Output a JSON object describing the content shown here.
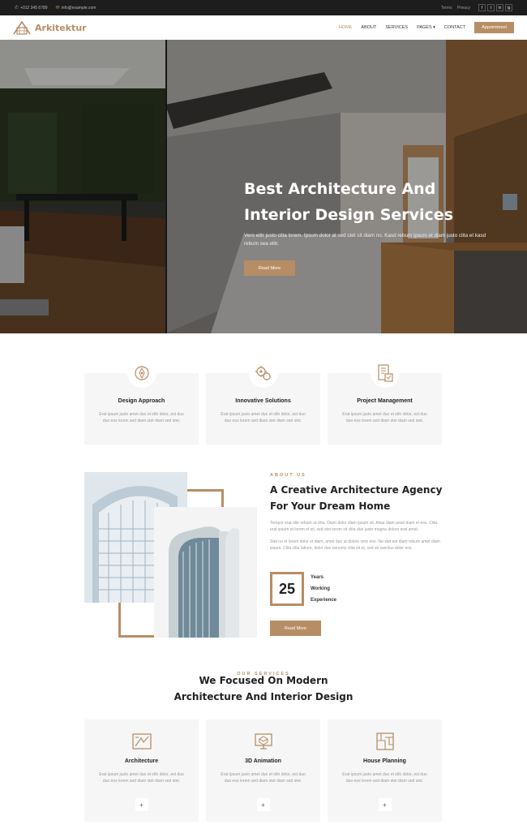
{
  "topbar": {
    "phone": "+012 345 6789",
    "email": "info@example.com",
    "links": [
      "Terms",
      "Privacy"
    ],
    "social": [
      "f",
      "t",
      "in",
      "ig"
    ]
  },
  "nav": {
    "brand": "Arkitektur",
    "items": [
      "HOME",
      "ABOUT",
      "SERVICES",
      "PAGES",
      "CONTACT"
    ],
    "active": "HOME",
    "appointment": "Appointment"
  },
  "hero": {
    "title": "Best Architecture And Interior Design Services",
    "text": "Vero elitr justo clita lorem. Ipsum dolor at sed stet sit diam no. Kasd rebum ipsum et diam justo clita et kasd rebum sea elitr.",
    "button": "Read More"
  },
  "features": [
    {
      "title": "Design Approach",
      "text": "Erat ipsum justo amet duo et elitr dolor, est duo duo eos lorem sed diam stet diam sed stet.",
      "icon": "design-approach-icon"
    },
    {
      "title": "Innovative Solutions",
      "text": "Erat ipsum justo amet duo et elitr dolor, est duo duo eos lorem sed diam stet diam sed stet.",
      "icon": "gears-icon"
    },
    {
      "title": "Project Management",
      "text": "Erat ipsum justo amet duo et elitr dolor, est duo duo eos lorem sed diam stet diam sed stet.",
      "icon": "project-management-icon"
    }
  ],
  "about": {
    "kicker": "ABOUT US",
    "title": "A Creative Architecture Agency For Your Dream Home",
    "para1": "Tempor erat elitr rebum at clita. Diam dolor diam ipsum sit. Aliqu diam amet diam et eos. Clita erat ipsum et lorem et sit, sed stet lorem sit clita duo justo magna dolore erat amet.",
    "para2": "Stet no et lorem dolor et diam, amet duo ut dolore vero eos. No stet est diam rebum amet diam ipsum. Clita clita labore, dolor duo nonumy clita sit at, sed sit sanctus dolor eos.",
    "years": "25",
    "years_label": [
      "Years",
      "Working",
      "Experience"
    ],
    "button": "Read More"
  },
  "services": {
    "kicker": "OUR SERVICES",
    "title_line1": "We Focused On Modern",
    "title_line2": "Architecture And Interior Design",
    "items": [
      {
        "title": "Architecture",
        "text": "Erat ipsum justo amet duo et elitr dolor, est duo duo eos lorem sed diam stet diam sed stet.",
        "icon": "architecture-icon",
        "plus": "+"
      },
      {
        "title": "3D Animation",
        "text": "Erat ipsum justo amet duo et elitr dolor, est duo duo eos lorem sed diam stet diam sed stet.",
        "icon": "3d-animation-icon",
        "plus": "+"
      },
      {
        "title": "House Planning",
        "text": "Erat ipsum justo amet duo et elitr dolor, est duo duo eos lorem sed diam stet diam sed stet.",
        "icon": "house-planning-icon",
        "plus": "+"
      }
    ]
  },
  "colors": {
    "accent": "#b78d65",
    "dark": "#1d1d1d",
    "card": "#f6f6f6"
  }
}
